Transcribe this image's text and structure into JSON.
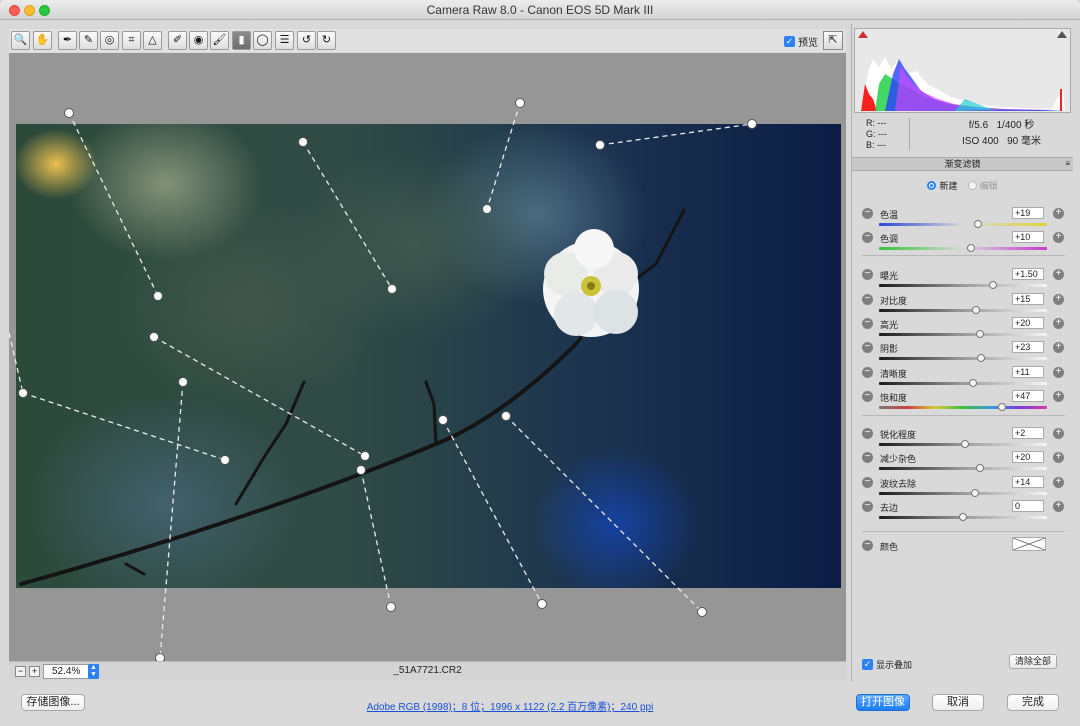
{
  "window": {
    "title": "Camera Raw 8.0 -  Canon EOS 5D Mark III"
  },
  "toolbar": {
    "tools": [
      {
        "icon": "zoom-icon",
        "glyph": "🔍"
      },
      {
        "icon": "hand-icon",
        "glyph": "✋"
      },
      {
        "icon": "white-balance-icon",
        "glyph": "✒"
      },
      {
        "icon": "color-sampler-icon",
        "glyph": "✎"
      },
      {
        "icon": "target-adjust-icon",
        "glyph": "◎"
      },
      {
        "icon": "crop-icon",
        "glyph": "⌗"
      },
      {
        "icon": "straighten-icon",
        "glyph": "△"
      },
      {
        "icon": "spot-removal-icon",
        "glyph": "✐"
      },
      {
        "icon": "red-eye-icon",
        "glyph": "◉"
      },
      {
        "icon": "adjustment-brush-icon",
        "glyph": "🖌"
      },
      {
        "icon": "graduated-filter-icon",
        "glyph": "▮"
      },
      {
        "icon": "radial-filter-icon",
        "glyph": "◯"
      },
      {
        "icon": "preferences-icon",
        "glyph": "☰"
      },
      {
        "icon": "rotate-left-icon",
        "glyph": "↺"
      },
      {
        "icon": "rotate-right-icon",
        "glyph": "↻"
      }
    ],
    "preview_label": "预览",
    "preview_checked": true
  },
  "histogram": {
    "colors": {
      "red": "#ff2020",
      "green": "#20d040",
      "blue": "#2040ff"
    }
  },
  "info": {
    "r_label": "R:",
    "g_label": "G:",
    "b_label": "B:",
    "r_val": "---",
    "g_val": "---",
    "b_val": "---",
    "aperture": "f/5.6",
    "shutter": "1/400 秒",
    "iso": "ISO 400",
    "focal": "90 毫米"
  },
  "panel": {
    "title": "渐变滤镜",
    "mode_new": "新建",
    "mode_edit": "编辑"
  },
  "sliders": [
    {
      "name": "color-temp",
      "label": "色温",
      "value": "+19",
      "pos": 0.59,
      "track": "temp"
    },
    {
      "name": "tint",
      "label": "色调",
      "value": "+10",
      "pos": 0.55,
      "track": "tint"
    },
    {
      "name": "exposure",
      "label": "曝光",
      "value": "+1.50",
      "pos": 0.68,
      "track": "gray"
    },
    {
      "name": "contrast",
      "label": "对比度",
      "value": "+15",
      "pos": 0.58,
      "track": "gray"
    },
    {
      "name": "highlights",
      "label": "高光",
      "value": "+20",
      "pos": 0.6,
      "track": "gray"
    },
    {
      "name": "shadows",
      "label": "阴影",
      "value": "+23",
      "pos": 0.61,
      "track": "gray"
    },
    {
      "name": "clarity",
      "label": "清晰度",
      "value": "+11",
      "pos": 0.56,
      "track": "gray"
    },
    {
      "name": "saturation",
      "label": "饱和度",
      "value": "+47",
      "pos": 0.73,
      "track": "sat"
    },
    {
      "name": "sharpness",
      "label": "锐化程度",
      "value": "+2",
      "pos": 0.51,
      "track": "gray"
    },
    {
      "name": "noise-reduction",
      "label": "减少杂色",
      "value": "+20",
      "pos": 0.6,
      "track": "gray"
    },
    {
      "name": "moire-reduction",
      "label": "波纹去除",
      "value": "+14",
      "pos": 0.57,
      "track": "gray"
    },
    {
      "name": "defringe",
      "label": "去边",
      "value": "0",
      "pos": 0.5,
      "track": "gray"
    }
  ],
  "color_label": "颜色",
  "show_overlay_label": "显示叠加",
  "show_overlay_checked": true,
  "clear_all_label": "清除全部",
  "status": {
    "zoom": "52.4%",
    "filename": "_51A7721.CR2"
  },
  "bottom": {
    "save_label": "存储图像...",
    "workflow_link": "Adobe RGB (1998)；8 位；1996 x 1122 (2.2 百万像素)；240 ppi",
    "open_label": "打开图像",
    "cancel_label": "取消",
    "done_label": "完成"
  }
}
